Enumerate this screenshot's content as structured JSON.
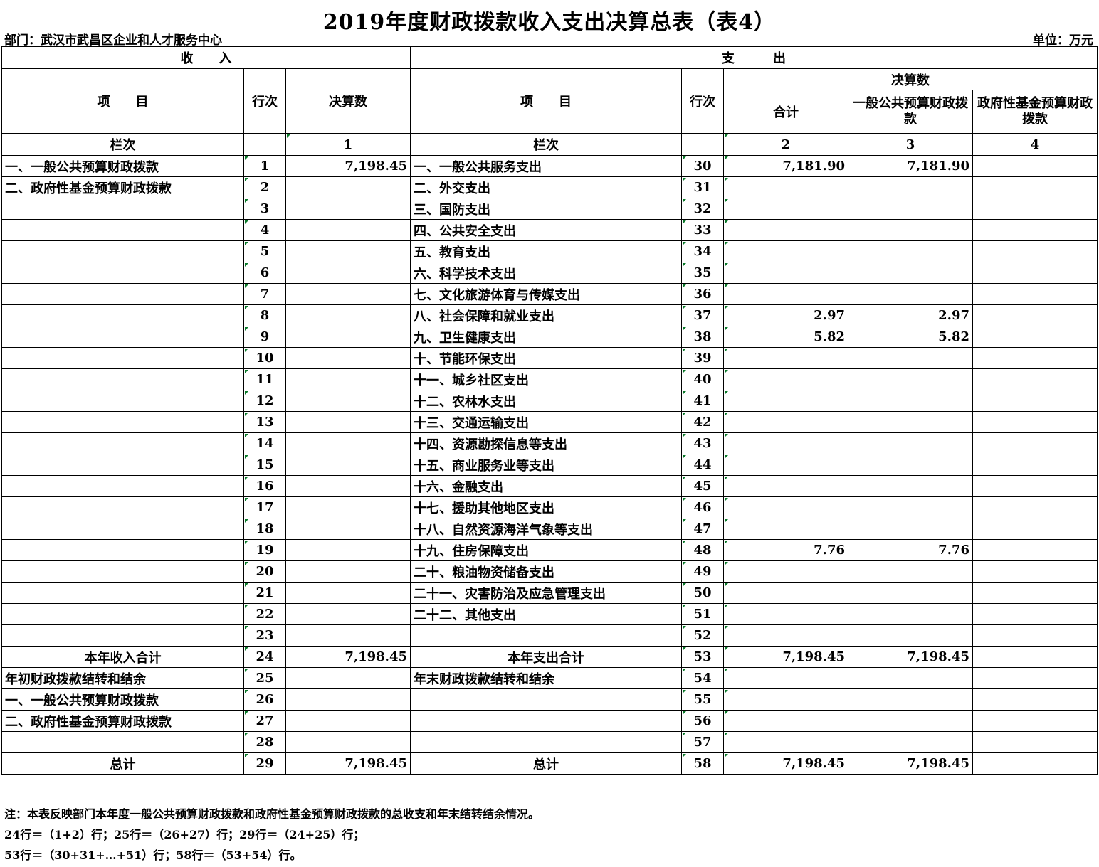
{
  "title": "2019年度财政拨款收入支出决算总表（表4）",
  "department": "部门：武汉市武昌区企业和人才服务中心",
  "unit": "单位：万元",
  "header": {
    "income": "收　　入",
    "expense": "支　　　出",
    "item": "项　　目",
    "row_no": "行次",
    "final_amount": "决算数",
    "total": "合计",
    "general_budget": "一般公共预算财政拨款",
    "gov_fund": "政府性基金预算财政拨款",
    "column_no": "栏次",
    "col1": "1",
    "col2": "2",
    "col3": "3",
    "col4": "4"
  },
  "rows": [
    {
      "in_item": "一、一般公共预算财政拨款",
      "in_no": "1",
      "in_amt": "7,198.45",
      "ex_item": "一、一般公共服务支出",
      "ex_no": "30",
      "total": "7,181.90",
      "general": "7,181.90",
      "fund": ""
    },
    {
      "in_item": "二、政府性基金预算财政拨款",
      "in_no": "2",
      "in_amt": "",
      "ex_item": "二、外交支出",
      "ex_no": "31",
      "total": "",
      "general": "",
      "fund": ""
    },
    {
      "in_item": "",
      "in_no": "3",
      "in_amt": "",
      "ex_item": "三、国防支出",
      "ex_no": "32",
      "total": "",
      "general": "",
      "fund": ""
    },
    {
      "in_item": "",
      "in_no": "4",
      "in_amt": "",
      "ex_item": "四、公共安全支出",
      "ex_no": "33",
      "total": "",
      "general": "",
      "fund": ""
    },
    {
      "in_item": "",
      "in_no": "5",
      "in_amt": "",
      "ex_item": "五、教育支出",
      "ex_no": "34",
      "total": "",
      "general": "",
      "fund": ""
    },
    {
      "in_item": "",
      "in_no": "6",
      "in_amt": "",
      "ex_item": "六、科学技术支出",
      "ex_no": "35",
      "total": "",
      "general": "",
      "fund": ""
    },
    {
      "in_item": "",
      "in_no": "7",
      "in_amt": "",
      "ex_item": "七、文化旅游体育与传媒支出",
      "ex_no": "36",
      "total": "",
      "general": "",
      "fund": ""
    },
    {
      "in_item": "",
      "in_no": "8",
      "in_amt": "",
      "ex_item": "八、社会保障和就业支出",
      "ex_no": "37",
      "total": "2.97",
      "general": "2.97",
      "fund": ""
    },
    {
      "in_item": "",
      "in_no": "9",
      "in_amt": "",
      "ex_item": "九、卫生健康支出",
      "ex_no": "38",
      "total": "5.82",
      "general": "5.82",
      "fund": ""
    },
    {
      "in_item": "",
      "in_no": "10",
      "in_amt": "",
      "ex_item": "十、节能环保支出",
      "ex_no": "39",
      "total": "",
      "general": "",
      "fund": ""
    },
    {
      "in_item": "",
      "in_no": "11",
      "in_amt": "",
      "ex_item": "十一、城乡社区支出",
      "ex_no": "40",
      "total": "",
      "general": "",
      "fund": ""
    },
    {
      "in_item": "",
      "in_no": "12",
      "in_amt": "",
      "ex_item": "十二、农林水支出",
      "ex_no": "41",
      "total": "",
      "general": "",
      "fund": ""
    },
    {
      "in_item": "",
      "in_no": "13",
      "in_amt": "",
      "ex_item": "十三、交通运输支出",
      "ex_no": "42",
      "total": "",
      "general": "",
      "fund": ""
    },
    {
      "in_item": "",
      "in_no": "14",
      "in_amt": "",
      "ex_item": "十四、资源勘探信息等支出",
      "ex_no": "43",
      "total": "",
      "general": "",
      "fund": ""
    },
    {
      "in_item": "",
      "in_no": "15",
      "in_amt": "",
      "ex_item": "十五、商业服务业等支出",
      "ex_no": "44",
      "total": "",
      "general": "",
      "fund": ""
    },
    {
      "in_item": "",
      "in_no": "16",
      "in_amt": "",
      "ex_item": "十六、金融支出",
      "ex_no": "45",
      "total": "",
      "general": "",
      "fund": ""
    },
    {
      "in_item": "",
      "in_no": "17",
      "in_amt": "",
      "ex_item": "十七、援助其他地区支出",
      "ex_no": "46",
      "total": "",
      "general": "",
      "fund": ""
    },
    {
      "in_item": "",
      "in_no": "18",
      "in_amt": "",
      "ex_item": "十八、自然资源海洋气象等支出",
      "ex_no": "47",
      "total": "",
      "general": "",
      "fund": ""
    },
    {
      "in_item": "",
      "in_no": "19",
      "in_amt": "",
      "ex_item": "十九、住房保障支出",
      "ex_no": "48",
      "total": "7.76",
      "general": "7.76",
      "fund": ""
    },
    {
      "in_item": "",
      "in_no": "20",
      "in_amt": "",
      "ex_item": "二十、粮油物资储备支出",
      "ex_no": "49",
      "total": "",
      "general": "",
      "fund": ""
    },
    {
      "in_item": "",
      "in_no": "21",
      "in_amt": "",
      "ex_item": "二十一、灾害防治及应急管理支出",
      "ex_no": "50",
      "total": "",
      "general": "",
      "fund": ""
    },
    {
      "in_item": "",
      "in_no": "22",
      "in_amt": "",
      "ex_item": "二十二、其他支出",
      "ex_no": "51",
      "total": "",
      "general": "",
      "fund": ""
    },
    {
      "in_item": "",
      "in_no": "23",
      "in_amt": "",
      "ex_item": "",
      "ex_no": "52",
      "total": "",
      "general": "",
      "fund": ""
    },
    {
      "in_item": "本年收入合计",
      "in_no": "24",
      "in_amt": "7,198.45",
      "ex_item": "本年支出合计",
      "ex_no": "53",
      "total": "7,198.45",
      "general": "7,198.45",
      "fund": "",
      "center": true
    },
    {
      "in_item": "年初财政拨款结转和结余",
      "in_no": "25",
      "in_amt": "",
      "ex_item": "年末财政拨款结转和结余",
      "ex_no": "54",
      "total": "",
      "general": "",
      "fund": ""
    },
    {
      "in_item": "一、一般公共预算财政拨款",
      "in_no": "26",
      "in_amt": "",
      "ex_item": "",
      "ex_no": "55",
      "total": "",
      "general": "",
      "fund": ""
    },
    {
      "in_item": "二、政府性基金预算财政拨款",
      "in_no": "27",
      "in_amt": "",
      "ex_item": "",
      "ex_no": "56",
      "total": "",
      "general": "",
      "fund": ""
    },
    {
      "in_item": "",
      "in_no": "28",
      "in_amt": "",
      "ex_item": "",
      "ex_no": "57",
      "total": "",
      "general": "",
      "fund": ""
    },
    {
      "in_item": "总计",
      "in_no": "29",
      "in_amt": "7,198.45",
      "ex_item": "总计",
      "ex_no": "58",
      "total": "7,198.45",
      "general": "7,198.45",
      "fund": "",
      "center": true
    }
  ],
  "notes": [
    "注：本表反映部门本年度一般公共预算财政拨款和政府性基金预算财政拨款的总收支和年末结转结余情况。",
    "24行＝（1+2）行；25行＝（26+27）行；29行＝（24+25）行；",
    "53行＝（30+31+…+51）行；58行＝（53+54）行。"
  ]
}
